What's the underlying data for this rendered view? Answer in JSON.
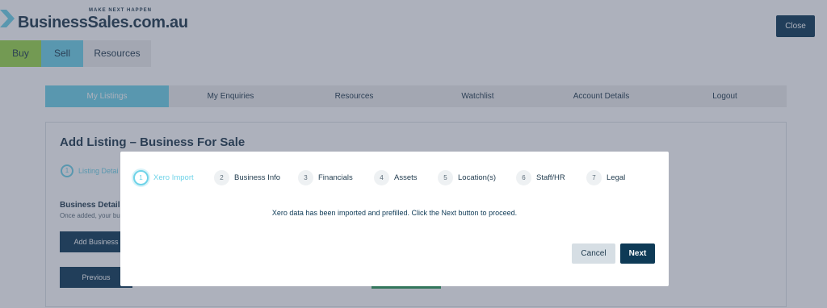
{
  "brand": {
    "name": "BusinessSales.com.au",
    "tagline": "MAKE NEXT HAPPEN"
  },
  "top_nav": [
    "Buy",
    "Sell",
    "Resources"
  ],
  "close_label": "Close",
  "account_tabs": [
    "My Listings",
    "My Enquiries",
    "Resources",
    "Watchlist",
    "Account Details",
    "Logout"
  ],
  "panel": {
    "title": "Add Listing – Business For Sale",
    "step_number": "1",
    "step_label": "Listing Detai",
    "business_details": "Business Details",
    "business_sub": "Once added, your bu",
    "add_business": "Add Business",
    "previous": "Previous"
  },
  "modal": {
    "steps": [
      {
        "num": "1",
        "label": "Xero Import",
        "active": true
      },
      {
        "num": "2",
        "label": "Business Info",
        "active": false
      },
      {
        "num": "3",
        "label": "Financials",
        "active": false
      },
      {
        "num": "4",
        "label": "Assets",
        "active": false
      },
      {
        "num": "5",
        "label": "Location(s)",
        "active": false
      },
      {
        "num": "6",
        "label": "Staff/HR",
        "active": false
      },
      {
        "num": "7",
        "label": "Legal",
        "active": false
      }
    ],
    "message": "Xero data has been imported and prefilled. Click the Next button to proceed.",
    "cancel": "Cancel",
    "next": "Next"
  },
  "colors": {
    "navy": "#0e3a56",
    "cyan": "#6fd3e8",
    "green": "#9bd84a"
  }
}
